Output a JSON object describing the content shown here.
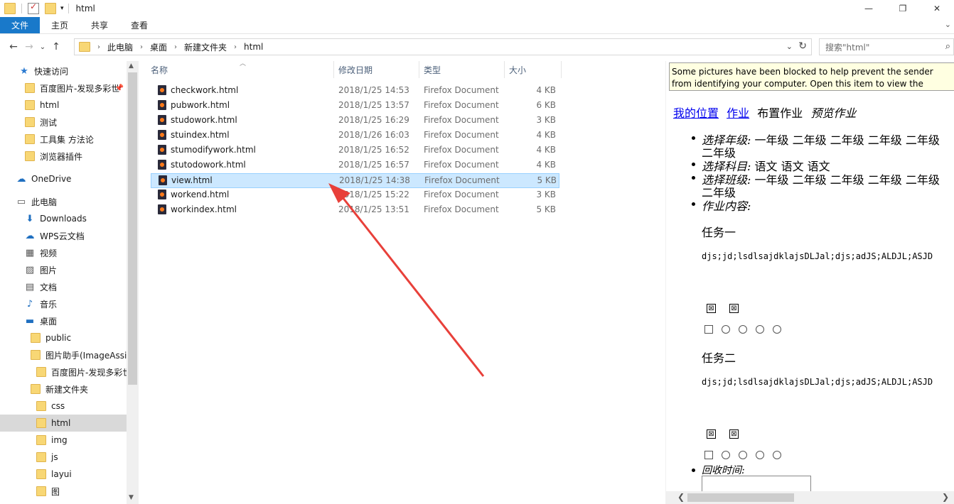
{
  "window": {
    "title": "html",
    "minimize": "—",
    "maximize": "❐",
    "close": "✕"
  },
  "ribbon": {
    "tabs": [
      "文件",
      "主页",
      "共享",
      "查看"
    ],
    "expand": "⌄"
  },
  "nav": {
    "back": "←",
    "forward": "→",
    "recent": "⌄",
    "up": "↑"
  },
  "address": {
    "crumbs": [
      "此电脑",
      "桌面",
      "新建文件夹",
      "html"
    ],
    "dropdown": "⌄",
    "refresh": "↻"
  },
  "search": {
    "placeholder": "搜索\"html\"",
    "icon": "⌕"
  },
  "sidebar": {
    "items": [
      {
        "label": "快速访问",
        "icon": "star-icon",
        "glyph": "★"
      },
      {
        "label": "百度图片-发现多彩世",
        "icon": "folder-icon",
        "pin": "📌"
      },
      {
        "label": "html",
        "icon": "folder-icon"
      },
      {
        "label": "测试",
        "icon": "folder-icon"
      },
      {
        "label": "工具集 方法论",
        "icon": "folder-icon"
      },
      {
        "label": "浏览器插件",
        "icon": "folder-icon"
      },
      {
        "label": "OneDrive",
        "icon": "cloud-icon",
        "glyph": "☁"
      },
      {
        "label": "此电脑",
        "icon": "computer-icon",
        "glyph": "▭"
      },
      {
        "label": "Downloads",
        "icon": "download-icon",
        "glyph": "⬇"
      },
      {
        "label": "WPS云文档",
        "icon": "cloud-icon",
        "glyph": "☁"
      },
      {
        "label": "视频",
        "icon": "video-icon",
        "glyph": "▦"
      },
      {
        "label": "图片",
        "icon": "picture-icon",
        "glyph": "▨"
      },
      {
        "label": "文档",
        "icon": "document-icon",
        "glyph": "▤"
      },
      {
        "label": "音乐",
        "icon": "music-icon",
        "glyph": "♪"
      },
      {
        "label": "桌面",
        "icon": "desktop-icon",
        "glyph": "▬"
      },
      {
        "label": "public",
        "icon": "folder-icon"
      },
      {
        "label": "图片助手(ImageAssis",
        "icon": "folder-icon"
      },
      {
        "label": "百度图片-发现多彩世",
        "icon": "folder-icon"
      },
      {
        "label": "新建文件夹",
        "icon": "folder-icon"
      },
      {
        "label": "css",
        "icon": "folder-icon"
      },
      {
        "label": "html",
        "icon": "folder-icon"
      },
      {
        "label": "img",
        "icon": "folder-icon"
      },
      {
        "label": "js",
        "icon": "folder-icon"
      },
      {
        "label": "layui",
        "icon": "folder-icon"
      },
      {
        "label": "图",
        "icon": "folder-icon"
      }
    ]
  },
  "filelist": {
    "columns": [
      "名称",
      "修改日期",
      "类型",
      "大小"
    ],
    "rows": [
      {
        "name": "checkwork.html",
        "date": "2018/1/25 14:53",
        "type": "Firefox Document",
        "size": "4 KB"
      },
      {
        "name": "pubwork.html",
        "date": "2018/1/25 13:57",
        "type": "Firefox Document",
        "size": "6 KB"
      },
      {
        "name": "studowork.html",
        "date": "2018/1/25 16:29",
        "type": "Firefox Document",
        "size": "3 KB"
      },
      {
        "name": "stuindex.html",
        "date": "2018/1/26 16:03",
        "type": "Firefox Document",
        "size": "4 KB"
      },
      {
        "name": "stumodifywork.html",
        "date": "2018/1/25 16:52",
        "type": "Firefox Document",
        "size": "4 KB"
      },
      {
        "name": "stutodowork.html",
        "date": "2018/1/25 16:57",
        "type": "Firefox Document",
        "size": "4 KB"
      },
      {
        "name": "view.html",
        "date": "2018/1/25 14:38",
        "type": "Firefox Document",
        "size": "5 KB"
      },
      {
        "name": "workend.html",
        "date": "2018/1/25 15:22",
        "type": "Firefox Document",
        "size": "3 KB"
      },
      {
        "name": "workindex.html",
        "date": "2018/1/25 13:51",
        "type": "Firefox Document",
        "size": "5 KB"
      }
    ]
  },
  "preview": {
    "infobar": "Some pictures have been blocked to help prevent the sender from identifying your computer. Open this item to view the pictures.",
    "links": [
      "我的位置",
      "作业"
    ],
    "crumb_plain": "布置作业",
    "crumb_italic": "预览作业",
    "grade_label": "选择年级:",
    "grade_values": "一年级  二年级  二年级  二年级  二年级",
    "grade_wrap": "二年级",
    "subject_label": "选择科目:",
    "subject_values": "语文  语文  语文",
    "class_label": "选择班级:",
    "class_values": "一年级  二年级  二年级  二年级  二年级",
    "class_wrap": "二年级",
    "content_label": "作业内容:",
    "task1": "任务一",
    "task2": "任务二",
    "task_text": "djs;jd;lsdlsajdklajsDLJal;djs;adJS;ALDJL;ASJD",
    "broken_image": "⊠",
    "recycle_label": "回收时间:",
    "scroll_left": "❮",
    "scroll_right": "❯"
  }
}
